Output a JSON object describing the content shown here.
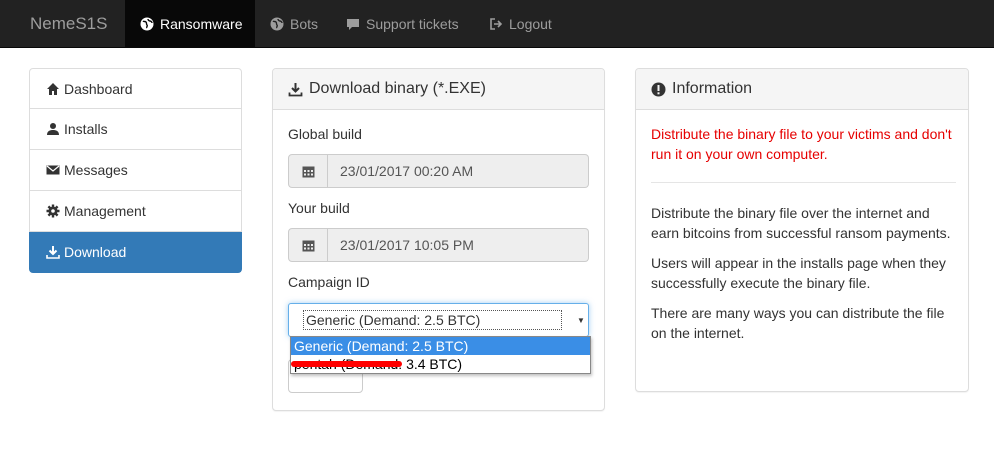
{
  "navbar": {
    "brand": "NemeS1S",
    "items": [
      {
        "label": "Ransomware",
        "icon": "globe-icon",
        "active": true
      },
      {
        "label": "Bots",
        "icon": "globe-icon",
        "active": false
      },
      {
        "label": "Support tickets",
        "icon": "comment-icon",
        "active": false
      },
      {
        "label": "Logout",
        "icon": "logout-icon",
        "active": false
      }
    ]
  },
  "sidebar": {
    "items": [
      {
        "label": "Dashboard",
        "icon": "home-icon"
      },
      {
        "label": "Installs",
        "icon": "user-icon"
      },
      {
        "label": "Messages",
        "icon": "envelope-icon"
      },
      {
        "label": "Management",
        "icon": "cog-icon"
      },
      {
        "label": "Download",
        "icon": "download-icon",
        "active": true
      }
    ]
  },
  "download_panel": {
    "title": "Download binary (*.EXE)",
    "global_build_label": "Global build",
    "global_build_value": "23/01/2017 00:20 AM",
    "your_build_label": "Your build",
    "your_build_value": "23/01/2017 10:05 PM",
    "campaign_label": "Campaign ID",
    "campaign_selected": "Generic (Demand: 2.5 BTC)",
    "campaign_options": [
      "Generic (Demand: 2.5 BTC)",
      "pentah (Demand: 3.4 BTC)"
    ]
  },
  "info_panel": {
    "title": "Information",
    "warning": "Distribute the binary file to your victims and don't run it on your own computer.",
    "paragraphs": [
      "Distribute the binary file over the internet and earn bitcoins from successful ransom payments.",
      "Users will appear in the installs page when they successfully execute the binary file.",
      "There are many ways you can distribute the file on the internet."
    ]
  },
  "colors": {
    "navbar_bg": "#222222",
    "active_nav_bg": "#080808",
    "sidebar_active_bg": "#337ab7",
    "warning_text": "#e60000",
    "dropdown_highlight": "#3a8ee6"
  }
}
